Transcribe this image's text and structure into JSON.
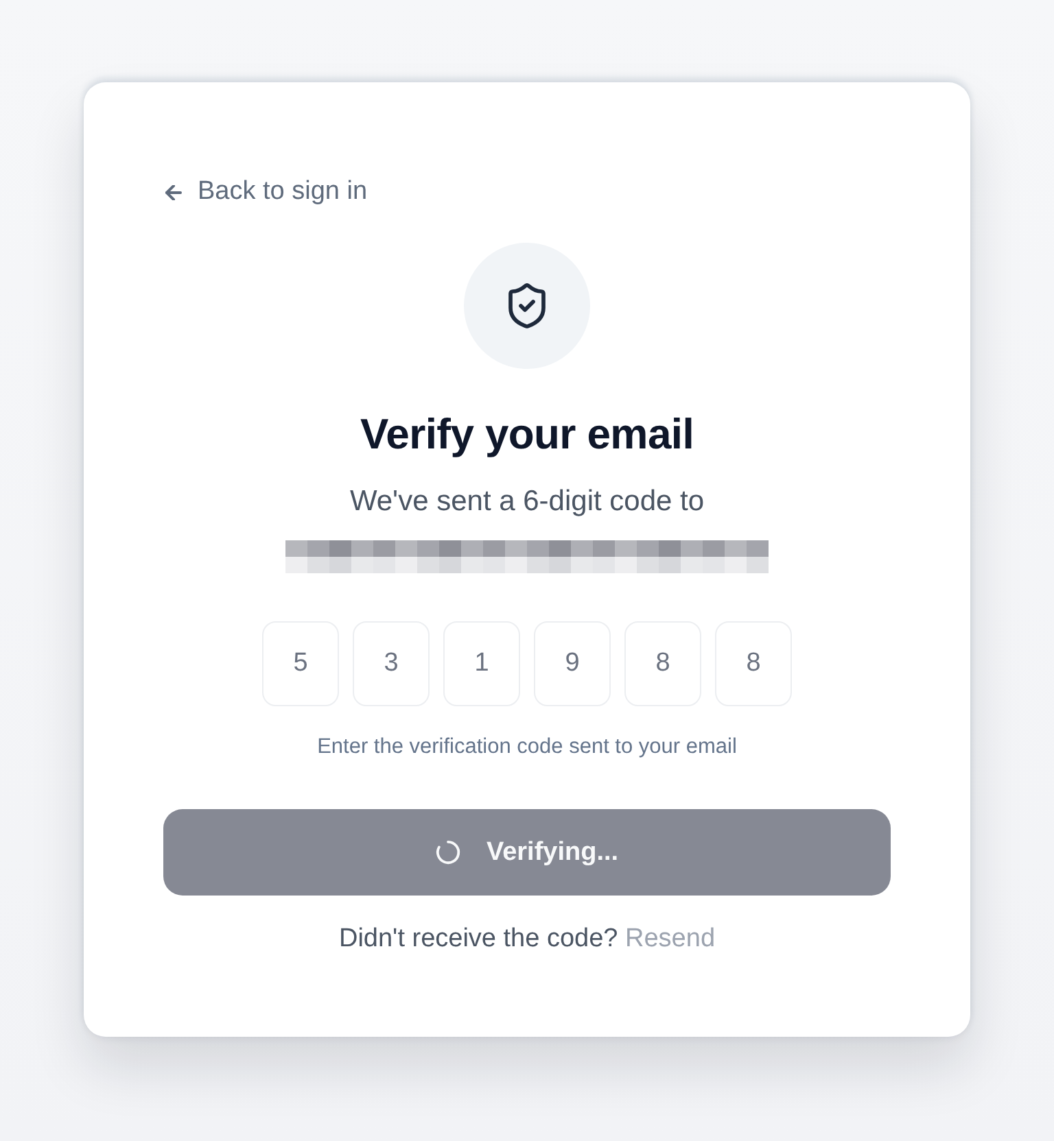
{
  "back_link": {
    "label": "Back to sign in"
  },
  "title": "Verify your email",
  "subtitle": "We've sent a 6-digit code to",
  "code": {
    "digits": [
      "5",
      "3",
      "1",
      "9",
      "8",
      "8"
    ],
    "disabled": true
  },
  "hint": "Enter the verification code sent to your email",
  "submit_button": {
    "label": "Verifying...",
    "loading": true,
    "disabled": true
  },
  "resend": {
    "prompt": "Didn't receive the code?",
    "link": "Resend",
    "disabled": true
  }
}
